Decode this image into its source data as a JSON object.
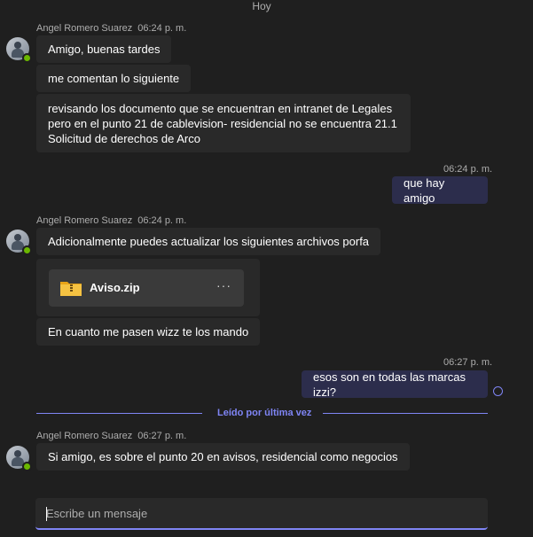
{
  "day_separator": "Hoy",
  "read_marker": "Leído por última vez",
  "compose": {
    "placeholder": "Escribe un mensaje"
  },
  "groups": [
    {
      "sender": "Angel Romero Suarez",
      "time": "06:24 p. m.",
      "messages": [
        "Amigo, buenas tardes",
        "me comentan lo siguiente",
        "revisando los documento que se encuentran en intranet de Legales pero en el punto 21 de cablevision- residencial no se encuentra  21.1 Solicitud de derechos de Arco"
      ]
    },
    {
      "mine": true,
      "time": "06:24 p. m.",
      "messages": [
        "que hay amigo"
      ]
    },
    {
      "sender": "Angel Romero Suarez",
      "time": "06:24 p. m.",
      "messages": [
        "Adicionalmente puedes actualizar los siguientes archivos porfa"
      ],
      "attachment": {
        "name": "Aviso.zip",
        "icon": "zip-folder-icon",
        "more": "···"
      },
      "after": [
        "En cuanto me pasen wizz te los mando"
      ]
    },
    {
      "mine": true,
      "time": "06:27 p. m.",
      "messages": [
        "esos son en todas las marcas izzi?"
      ]
    },
    {
      "sender": "Angel Romero Suarez",
      "time": "06:27 p. m.",
      "messages": [
        "Si amigo, es sobre el punto 20 en avisos, residencial como negocios"
      ]
    }
  ],
  "colors": {
    "accent": "#7f85f5",
    "presence": "#6bb700",
    "mine_bubble": "#2c2d4c",
    "their_bubble": "#292929"
  }
}
